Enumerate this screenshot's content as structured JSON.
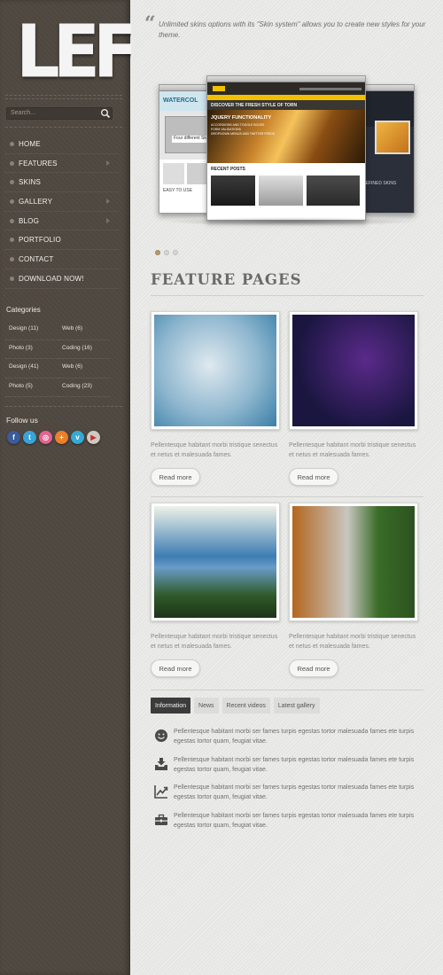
{
  "logo": {
    "text": "LEFT"
  },
  "search": {
    "placeholder": "Search..."
  },
  "nav": {
    "items": [
      {
        "label": "HOME",
        "has_submenu": false
      },
      {
        "label": "FEATURES",
        "has_submenu": true
      },
      {
        "label": "SKINS",
        "has_submenu": false
      },
      {
        "label": "GALLERY",
        "has_submenu": true
      },
      {
        "label": "BLOG",
        "has_submenu": true
      },
      {
        "label": "PORTFOLIO",
        "has_submenu": false
      },
      {
        "label": "CONTACT",
        "has_submenu": false
      },
      {
        "label": "DOWNLOAD NOW!",
        "has_submenu": false
      }
    ]
  },
  "categories": {
    "title": "Categories",
    "items": [
      "Design (11)",
      "Web (6)",
      "Photo (3)",
      "Coding (16)",
      "Design (41)",
      "Web (6)",
      "Photo (5)",
      "Coding (23)"
    ]
  },
  "follow": {
    "title": "Follow us",
    "icons": [
      "facebook-icon",
      "twitter-icon",
      "dribbble-icon",
      "google-plus-icon",
      "vimeo-icon",
      "youtube-icon"
    ],
    "glyphs": [
      "f",
      "t",
      "◎",
      "+",
      "v",
      "▶"
    ],
    "colors": [
      "#3b5b9a",
      "#3aa3d8",
      "#e4628f",
      "#e9802e",
      "#36a9d4",
      "#cfc9c2"
    ]
  },
  "intro": {
    "quote": "Unlimited skins options with its \"Skin system\" allows you to create new styles for your theme."
  },
  "slider": {
    "dots": 3,
    "active_index": 0,
    "center_shot": {
      "headline": "DISCOVER THE FRESH STYLE OF TORN",
      "feature_title": "JQUERY FUNCTIONALITY",
      "feature_lines": [
        "ACCORDIONS AND TOGGLE BOXES",
        "FORM VALIDATIONS",
        "DROPDOWN MENUS AND TWITTER FEEDS"
      ],
      "recent_label": "RECENT POSTS"
    },
    "left_shot": {
      "brand": "WATERCOL",
      "tagline": "Four different Sk",
      "footer": "EASY TO USE"
    },
    "right_shot": {
      "tagline": "REFINED SKINS"
    }
  },
  "feature_pages": {
    "title": "FEATURE PAGES",
    "cards": [
      {
        "text": "Pellentesque habitant morbi tristique senectus et netus et malesuada fames.",
        "button": "Read more",
        "palette": [
          "#dfe9ef",
          "#8fb7cf",
          "#3a7fa8"
        ]
      },
      {
        "text": "Pellentesque habitant morbi tristique senectus et netus et malesuada fames.",
        "button": "Read more",
        "palette": [
          "#1a1640",
          "#5a2a8a",
          "#2aa0c8"
        ]
      },
      {
        "text": "Pellentesque habitant morbi tristique senectus et netus et malesuada fames.",
        "button": "Read more",
        "palette": [
          "#eef2e8",
          "#3d7db3",
          "#2f5a2a"
        ]
      },
      {
        "text": "Pellentesque habitant morbi tristique senectus et netus et malesuada fames.",
        "button": "Read more",
        "palette": [
          "#c8c6c0",
          "#b4661f",
          "#3a6c27"
        ]
      }
    ]
  },
  "tabs": {
    "items": [
      "Information",
      "News",
      "Recent videos",
      "Latest gallery"
    ],
    "active_index": 0
  },
  "info_list": {
    "items": [
      {
        "icon": "smiley-icon",
        "text": "Pellentesque habitant morbi ser fames turpis egestas tortor malesuada fames ete turpis egestas tortor quam, feugiat vitae."
      },
      {
        "icon": "inbox-download-icon",
        "text": "Pellentesque habitant morbi ser fames turpis egestas tortor malesuada fames ete turpis egestas tortor quam, feugiat vitae."
      },
      {
        "icon": "line-chart-icon",
        "text": "Pellentesque habitant morbi ser fames turpis egestas tortor malesuada fames ete turpis egestas tortor quam, feugiat vitae."
      },
      {
        "icon": "toolbox-icon",
        "text": "Pellentesque habitant morbi ser fames turpis egestas tortor malesuada fames ete turpis egestas tortor quam, feugiat vitae."
      }
    ]
  },
  "colors": {
    "sidebar_bg": "#4f4840",
    "main_bg": "#e9e9e7",
    "accent_gold": "#b79a66",
    "active_tab": "#3c3c3c"
  }
}
